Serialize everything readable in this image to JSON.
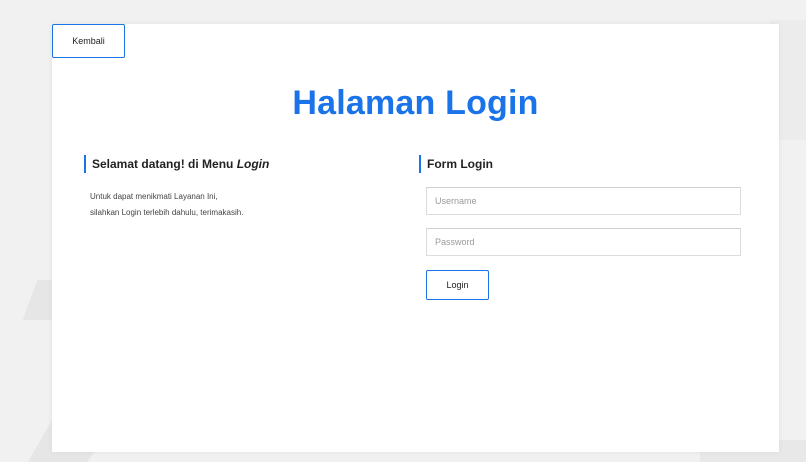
{
  "header": {
    "back_button_label": "Kembali",
    "page_title": "Halaman Login"
  },
  "welcome": {
    "heading_prefix": "Selamat datang! di Menu ",
    "heading_emphasis": "Login",
    "line1": "Untuk dapat menikmati Layanan Ini,",
    "line2": "silahkan Login terlebih dahulu, terimakasih."
  },
  "form": {
    "heading": "Form Login",
    "username_placeholder": "Username",
    "username_value": "",
    "password_placeholder": "Password",
    "password_value": "",
    "submit_label": "Login"
  },
  "colors": {
    "accent": "#1a73e8",
    "background": "#f1f1f1",
    "card": "#ffffff"
  }
}
